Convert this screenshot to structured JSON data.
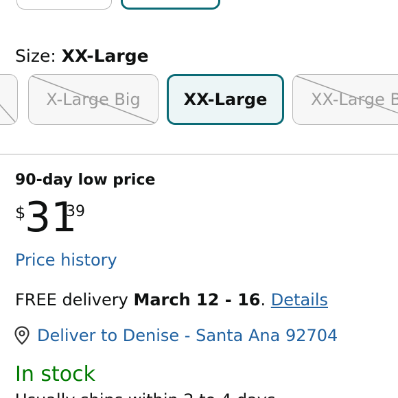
{
  "size": {
    "label": "Size:",
    "selected_value": "XX-Large",
    "options": [
      {
        "label": "",
        "available": false
      },
      {
        "label": "X-Large Big",
        "available": false
      },
      {
        "label": "XX-Large",
        "available": true,
        "selected": true
      },
      {
        "label": "XX-Large B",
        "available": false
      }
    ]
  },
  "pricing": {
    "badge": "90-day low price",
    "currency_symbol": "$",
    "whole": "31",
    "fraction": "39",
    "history_link": "Price history"
  },
  "delivery": {
    "prefix": "FREE delivery ",
    "date": "March 12 - 16",
    "separator": ". ",
    "details_link": "Details"
  },
  "location": {
    "icon": "location-pin-icon",
    "text": "Deliver to Denise - Santa Ana 92704"
  },
  "availability": {
    "status": "In stock",
    "shipping_note": "Usually ships within 2 to 4 days"
  },
  "colors": {
    "accent": "#0b6b76",
    "link": "#2162a1",
    "in_stock": "#007a00"
  }
}
